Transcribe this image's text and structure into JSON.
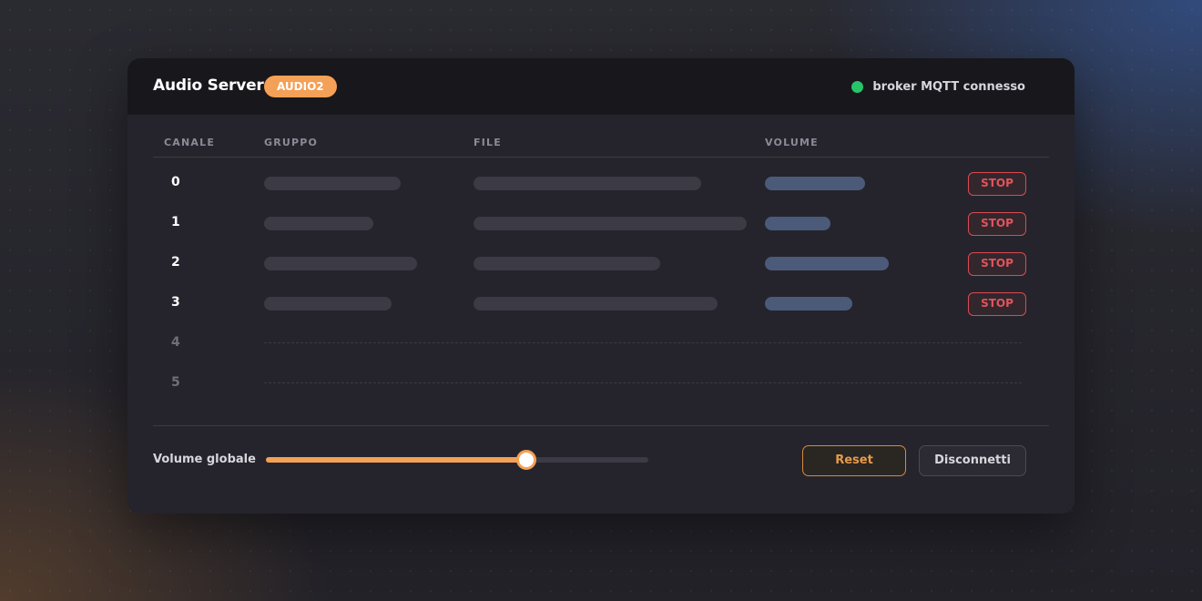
{
  "app": {
    "title": "Audio Server",
    "badge": "AUDIO2",
    "status_text": "broker MQTT connesso",
    "status_color": "#27c46a",
    "accent_color": "#f4a057",
    "danger_color": "#e2545c"
  },
  "table": {
    "headers": {
      "canale": "CANALE",
      "gruppo": "GRUPPO",
      "file": "FILE",
      "volume": "VOLUME"
    },
    "rows": [
      {
        "channel": "0",
        "active": true,
        "stop_label": "STOP"
      },
      {
        "channel": "1",
        "active": true,
        "stop_label": "STOP"
      },
      {
        "channel": "2",
        "active": true,
        "stop_label": "STOP"
      },
      {
        "channel": "3",
        "active": true,
        "stop_label": "STOP"
      },
      {
        "channel": "4",
        "active": false
      },
      {
        "channel": "5",
        "active": false
      }
    ]
  },
  "footer": {
    "volume_label": "Volume globale",
    "volume_level": 0.68,
    "reset_label": "Reset",
    "disconnect_label": "Disconnetti"
  }
}
